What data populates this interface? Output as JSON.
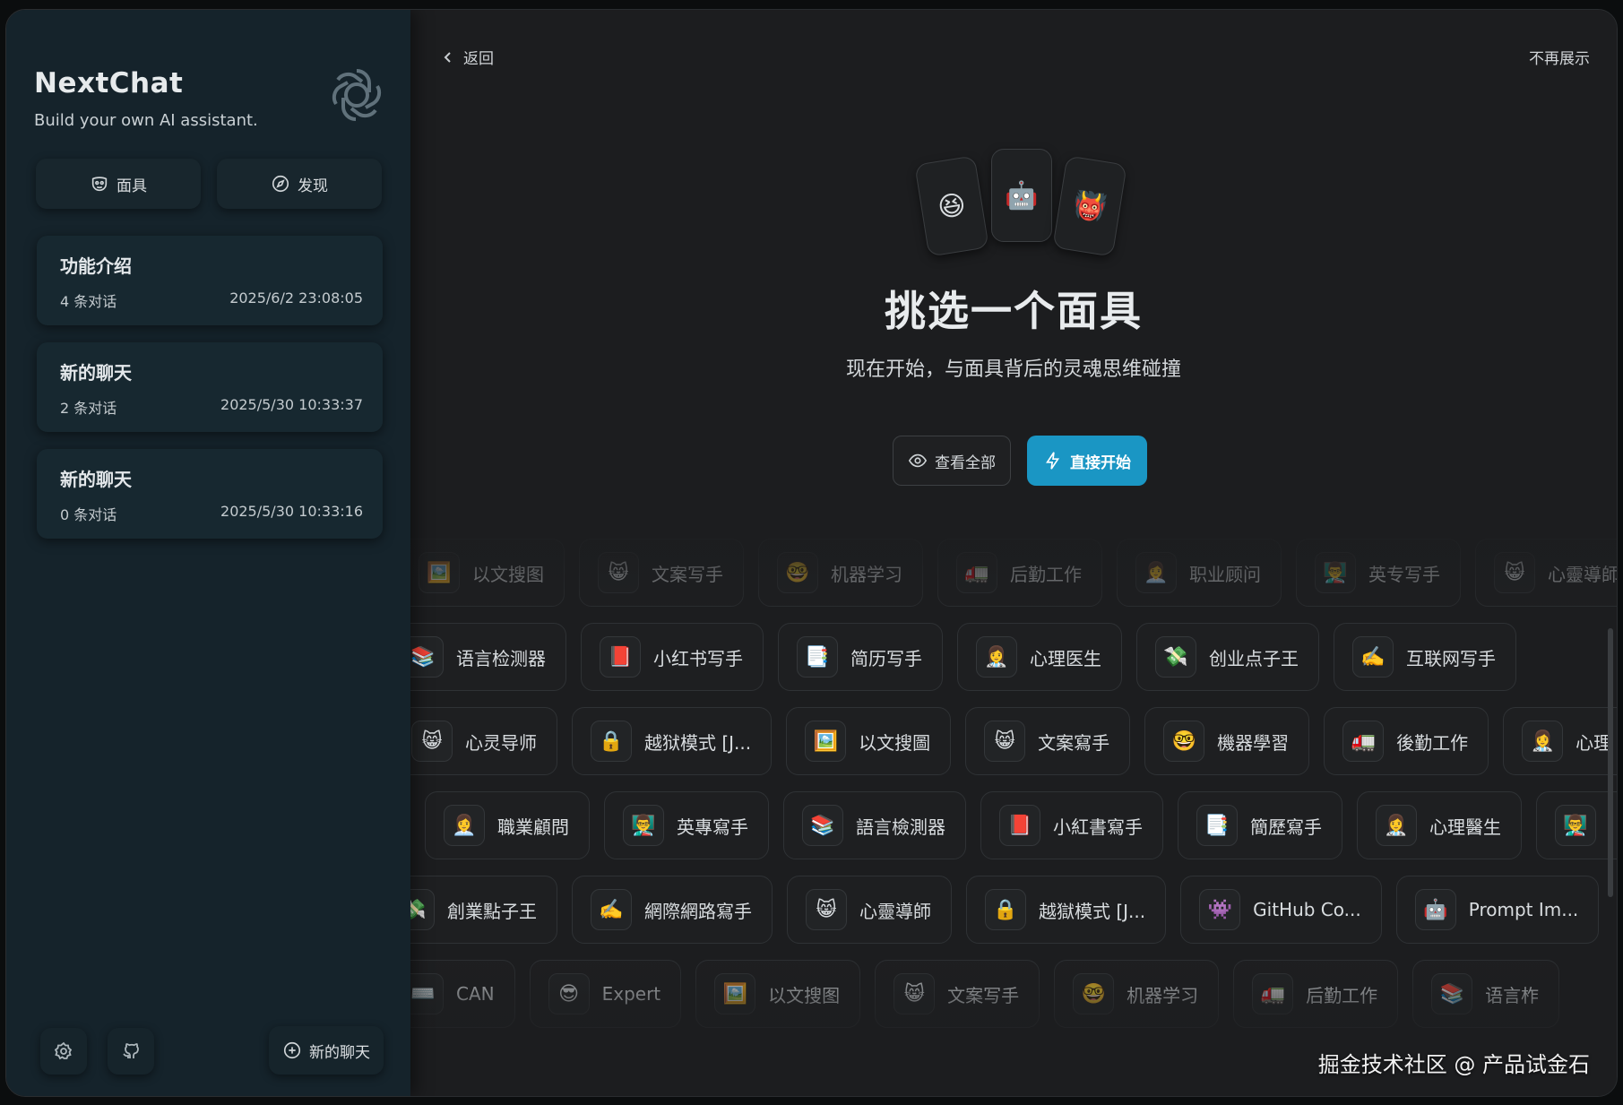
{
  "sidebar": {
    "brand_title": "NextChat",
    "brand_subtitle": "Build your own AI assistant.",
    "mask_button": "面具",
    "discover_button": "发现",
    "chats": [
      {
        "title": "功能介绍",
        "count": "4 条对话",
        "time": "2025/6/2 23:08:05"
      },
      {
        "title": "新的聊天",
        "count": "2 条对话",
        "time": "2025/5/30 10:33:37"
      },
      {
        "title": "新的聊天",
        "count": "0 条对话",
        "time": "2025/5/30 10:33:16"
      }
    ],
    "new_chat": "新的聊天"
  },
  "main": {
    "back_label": "返回",
    "dismiss_label": "不再展示",
    "hero_emojis": [
      "😆",
      "🤖",
      "👹"
    ],
    "title": "挑选一个面具",
    "subtitle": "现在开始，与面具背后的灵魂思维碰撞",
    "view_all": "查看全部",
    "start_now": "直接开始",
    "accent_color": "#1a96c4",
    "mask_rows": [
      [
        {
          "emoji": "🖼️",
          "label": "以文搜图"
        },
        {
          "emoji": "😸",
          "label": "文案写手"
        },
        {
          "emoji": "🤓",
          "label": "机器学习"
        },
        {
          "emoji": "🚛",
          "label": "后勤工作"
        },
        {
          "emoji": "👩‍💼",
          "label": "职业顾问"
        },
        {
          "emoji": "👨‍🏫",
          "label": "英专写手"
        },
        {
          "emoji": "😸",
          "label": "心靈導師"
        }
      ],
      [
        {
          "emoji": "📚",
          "label": "语言检测器"
        },
        {
          "emoji": "📕",
          "label": "小红书写手"
        },
        {
          "emoji": "📑",
          "label": "简历写手"
        },
        {
          "emoji": "👩‍⚕️",
          "label": "心理医生"
        },
        {
          "emoji": "💸",
          "label": "创业点子王"
        },
        {
          "emoji": "✍️",
          "label": "互联网写手"
        }
      ],
      [
        {
          "emoji": "😸",
          "label": "心灵导师"
        },
        {
          "emoji": "🔒",
          "label": "越狱模式 [J..."
        },
        {
          "emoji": "🖼️",
          "label": "以文搜圖"
        },
        {
          "emoji": "😸",
          "label": "文案寫手"
        },
        {
          "emoji": "🤓",
          "label": "機器學習"
        },
        {
          "emoji": "🚛",
          "label": "後勤工作"
        },
        {
          "emoji": "👩‍⚕️",
          "label": "心理"
        }
      ],
      [
        {
          "emoji": "👩‍💼",
          "label": "職業顧問"
        },
        {
          "emoji": "👨‍🏫",
          "label": "英專寫手"
        },
        {
          "emoji": "📚",
          "label": "語言檢測器"
        },
        {
          "emoji": "📕",
          "label": "小紅書寫手"
        },
        {
          "emoji": "📑",
          "label": "簡歷寫手"
        },
        {
          "emoji": "👩‍⚕️",
          "label": "心理醫生"
        },
        {
          "emoji": "👨‍🏫",
          "label": ""
        }
      ],
      [
        {
          "emoji": "💸",
          "label": "創業點子王"
        },
        {
          "emoji": "✍️",
          "label": "網際網路寫手"
        },
        {
          "emoji": "😸",
          "label": "心靈導師"
        },
        {
          "emoji": "🔒",
          "label": "越獄模式 [J..."
        },
        {
          "emoji": "👾",
          "label": "GitHub Co..."
        },
        {
          "emoji": "🤖",
          "label": "Prompt Im..."
        }
      ],
      [
        {
          "emoji": "⌨️",
          "label": "CAN"
        },
        {
          "emoji": "😎",
          "label": "Expert"
        },
        {
          "emoji": "🖼️",
          "label": "以文搜图"
        },
        {
          "emoji": "😸",
          "label": "文案写手"
        },
        {
          "emoji": "🤓",
          "label": "机器学习"
        },
        {
          "emoji": "🚛",
          "label": "后勤工作"
        },
        {
          "emoji": "📚",
          "label": "语言柞"
        }
      ]
    ]
  },
  "watermark": "掘金技术社区 @ 产品试金石"
}
